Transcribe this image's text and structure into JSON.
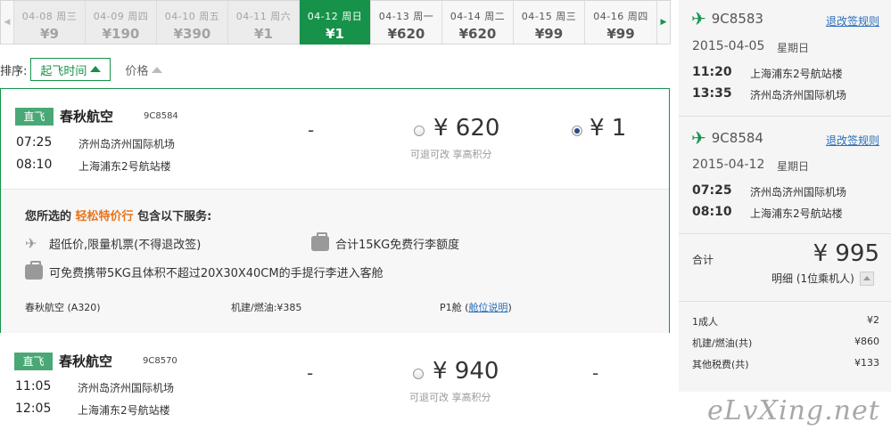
{
  "dates": [
    {
      "date": "04-08",
      "weekday": "周三",
      "price": "¥9",
      "state": "past"
    },
    {
      "date": "04-09",
      "weekday": "周四",
      "price": "¥190",
      "state": "past"
    },
    {
      "date": "04-10",
      "weekday": "周五",
      "price": "¥390",
      "state": "past"
    },
    {
      "date": "04-11",
      "weekday": "周六",
      "price": "¥1",
      "state": "past"
    },
    {
      "date": "04-12",
      "weekday": "周日",
      "price": "¥1",
      "state": "selected"
    },
    {
      "date": "04-13",
      "weekday": "周一",
      "price": "¥620",
      "state": "future"
    },
    {
      "date": "04-14",
      "weekday": "周二",
      "price": "¥620",
      "state": "future"
    },
    {
      "date": "04-15",
      "weekday": "周三",
      "price": "¥99",
      "state": "future"
    },
    {
      "date": "04-16",
      "weekday": "周四",
      "price": "¥99",
      "state": "future"
    }
  ],
  "sort": {
    "label": "排序:",
    "by_time": "起飞时间",
    "by_price": "价格"
  },
  "flights": [
    {
      "tag": "直飞",
      "airline": "春秋航空",
      "flight_no": "9C8584",
      "dep_time": "07:25",
      "dep_airport": "济州岛济州国际机场",
      "arr_time": "08:10",
      "arr_airport": "上海浦东2号航站楼",
      "col1": "-",
      "price_a": "¥ 620",
      "price_a_sub": "可退可改  享高积分",
      "price_b": "¥ 1"
    },
    {
      "tag": "直飞",
      "airline": "春秋航空",
      "flight_no": "9C8570",
      "dep_time": "11:05",
      "dep_airport": "济州岛济州国际机场",
      "arr_time": "12:05",
      "arr_airport": "上海浦东2号航站楼",
      "col1": "-",
      "price_a": "¥ 940",
      "price_a_sub": "可退可改  享高积分",
      "col3": "-"
    }
  ],
  "service": {
    "title_pre": "您所选的",
    "title_highlight": "轻松特价行",
    "title_post": "包含以下服务:",
    "item1": "超低价,限量机票(不得退改签)",
    "item2": "合计15KG免费行李额度",
    "item3": "可免费携带5KG且体积不超过20X30X40CM的手提行李进入客舱",
    "aircraft": "春秋航空 (A320)",
    "fuel": "机建/燃油:¥385",
    "cabin": "P1舱",
    "cabin_link": "舱位说明"
  },
  "side": {
    "rule_link": "退改签规则",
    "segments": [
      {
        "flight_no": "9C8583",
        "date": "2015-04-05",
        "weekday": "星期日",
        "dep_time": "11:20",
        "dep_airport": "上海浦东2号航站楼",
        "arr_time": "13:35",
        "arr_airport": "济州岛济州国际机场"
      },
      {
        "flight_no": "9C8584",
        "date": "2015-04-12",
        "weekday": "星期日",
        "dep_time": "07:25",
        "dep_airport": "济州岛济州国际机场",
        "arr_time": "08:10",
        "arr_airport": "上海浦东2号航站楼"
      }
    ],
    "total_label": "合计",
    "total_price": "¥ 995",
    "detail_label": "明细 (1位乘机人)",
    "fees": [
      {
        "label": "1成人",
        "value": "¥2"
      },
      {
        "label": "机建/燃油(共)",
        "value": "¥860"
      },
      {
        "label": "其他税费(共)",
        "value": "¥133"
      }
    ]
  },
  "watermark": "eLvXing.net",
  "colors": {
    "brand_green": "#17924a",
    "highlight_orange": "#e8741b",
    "link_blue": "#2a6fbb"
  }
}
